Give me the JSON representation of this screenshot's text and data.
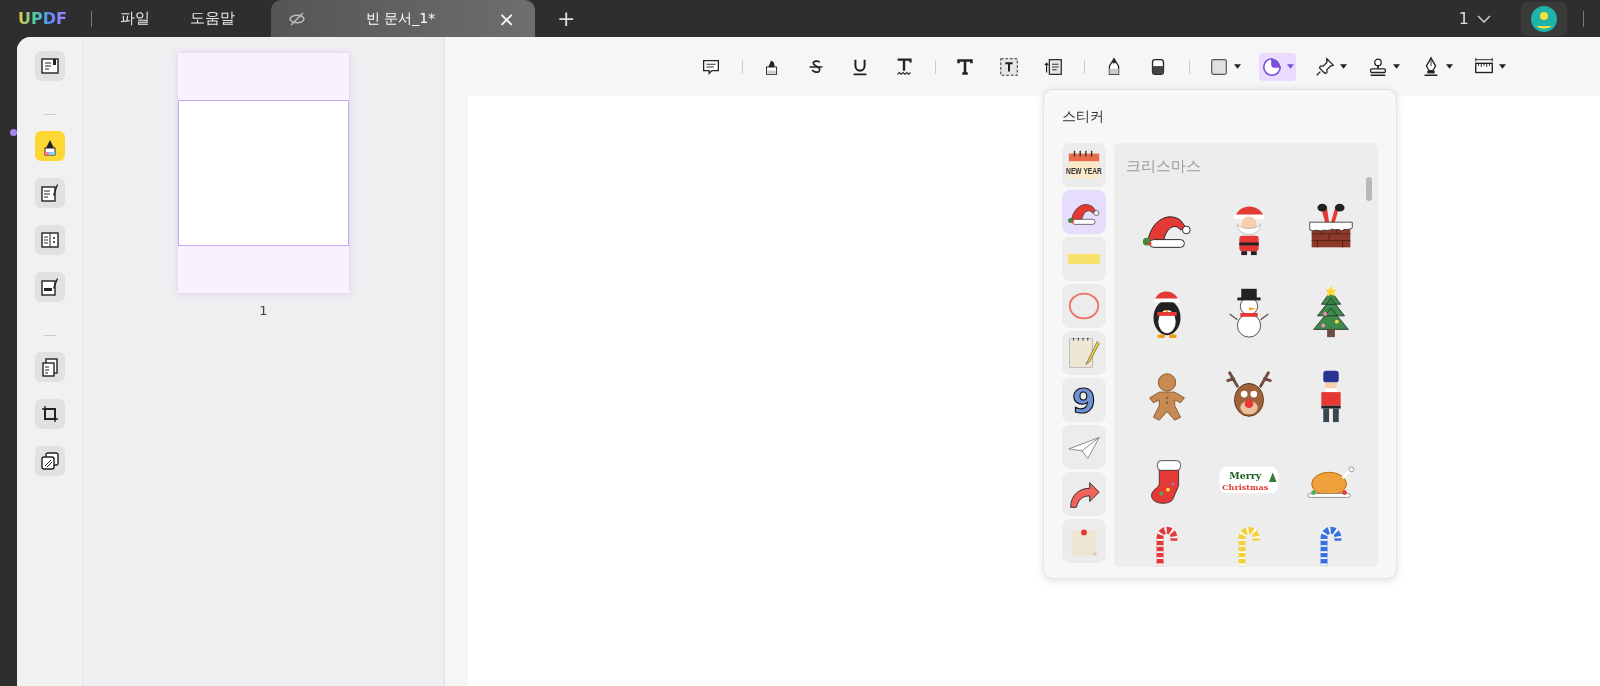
{
  "titlebar": {
    "logo": "UPDF",
    "menus": [
      {
        "label": "파일"
      },
      {
        "label": "도움말"
      }
    ],
    "tab": {
      "title": "빈 문서_1*",
      "close": "×",
      "selected": true
    },
    "new_tab": "+",
    "page_menu": {
      "value": "1"
    }
  },
  "sidebar": {
    "groups": [
      {
        "tools": [
          {
            "kind": "reader",
            "selected": false
          }
        ]
      },
      {
        "tools": [
          {
            "kind": "comment",
            "selected": true
          },
          {
            "kind": "edit",
            "selected": false
          },
          {
            "kind": "form",
            "selected": false
          },
          {
            "kind": "fill-sign",
            "selected": false
          }
        ]
      },
      {
        "tools": [
          {
            "kind": "organize",
            "selected": false
          },
          {
            "kind": "crop",
            "selected": false
          },
          {
            "kind": "protect",
            "selected": false
          }
        ]
      }
    ]
  },
  "thumbnails": [
    {
      "label": "1",
      "selected": true
    }
  ],
  "toolbar": {
    "groups": [
      {
        "tools": [
          {
            "kind": "comment",
            "selected": false,
            "dropdown": false
          }
        ]
      },
      {
        "tools": [
          {
            "kind": "highlight",
            "selected": false,
            "dropdown": false
          },
          {
            "kind": "strike",
            "selected": false,
            "dropdown": false
          },
          {
            "kind": "underline",
            "selected": false,
            "dropdown": false
          },
          {
            "kind": "squiggly",
            "selected": false,
            "dropdown": false
          }
        ]
      },
      {
        "tools": [
          {
            "kind": "text",
            "selected": false,
            "dropdown": false
          },
          {
            "kind": "textbox",
            "selected": false,
            "dropdown": false
          },
          {
            "kind": "callout",
            "selected": false,
            "dropdown": false
          }
        ]
      },
      {
        "tools": [
          {
            "kind": "pencil",
            "selected": false,
            "dropdown": false
          },
          {
            "kind": "eraser",
            "selected": false,
            "dropdown": false
          }
        ]
      },
      {
        "tools": [
          {
            "kind": "shape",
            "selected": false,
            "dropdown": true
          },
          {
            "kind": "sticker",
            "selected": true,
            "dropdown": true
          },
          {
            "kind": "pin",
            "selected": false,
            "dropdown": true
          },
          {
            "kind": "stamp",
            "selected": false,
            "dropdown": true
          },
          {
            "kind": "signature",
            "selected": false,
            "dropdown": true
          },
          {
            "kind": "measure",
            "selected": false,
            "dropdown": true
          }
        ]
      }
    ]
  },
  "sticker_panel": {
    "title": "스티커",
    "categories": [
      {
        "kind": "calendar",
        "text": "NEW YEAR",
        "selected": false
      },
      {
        "kind": "hat",
        "selected": true
      },
      {
        "kind": "tape",
        "selected": false
      },
      {
        "kind": "circle",
        "selected": false
      },
      {
        "kind": "notepad",
        "selected": false
      },
      {
        "kind": "number",
        "text": "9",
        "selected": false
      },
      {
        "kind": "plane",
        "selected": false
      },
      {
        "kind": "arrow",
        "selected": false
      },
      {
        "kind": "note",
        "selected": false
      }
    ],
    "section": "크리스마스",
    "stickers": [
      {
        "kind": "hat"
      },
      {
        "kind": "santa"
      },
      {
        "kind": "chimney"
      },
      {
        "kind": "penguin"
      },
      {
        "kind": "snowman"
      },
      {
        "kind": "tree"
      },
      {
        "kind": "gingerbread"
      },
      {
        "kind": "reindeer"
      },
      {
        "kind": "nutcracker"
      },
      {
        "kind": "stocking"
      },
      {
        "kind": "greeting",
        "lines": [
          "Merry",
          "Christmas"
        ]
      },
      {
        "kind": "turkey"
      },
      {
        "kind": "candy",
        "color": "#e03a3a"
      },
      {
        "kind": "candy",
        "color": "#f2d23c"
      },
      {
        "kind": "candy",
        "color": "#3a6fe0"
      }
    ]
  }
}
